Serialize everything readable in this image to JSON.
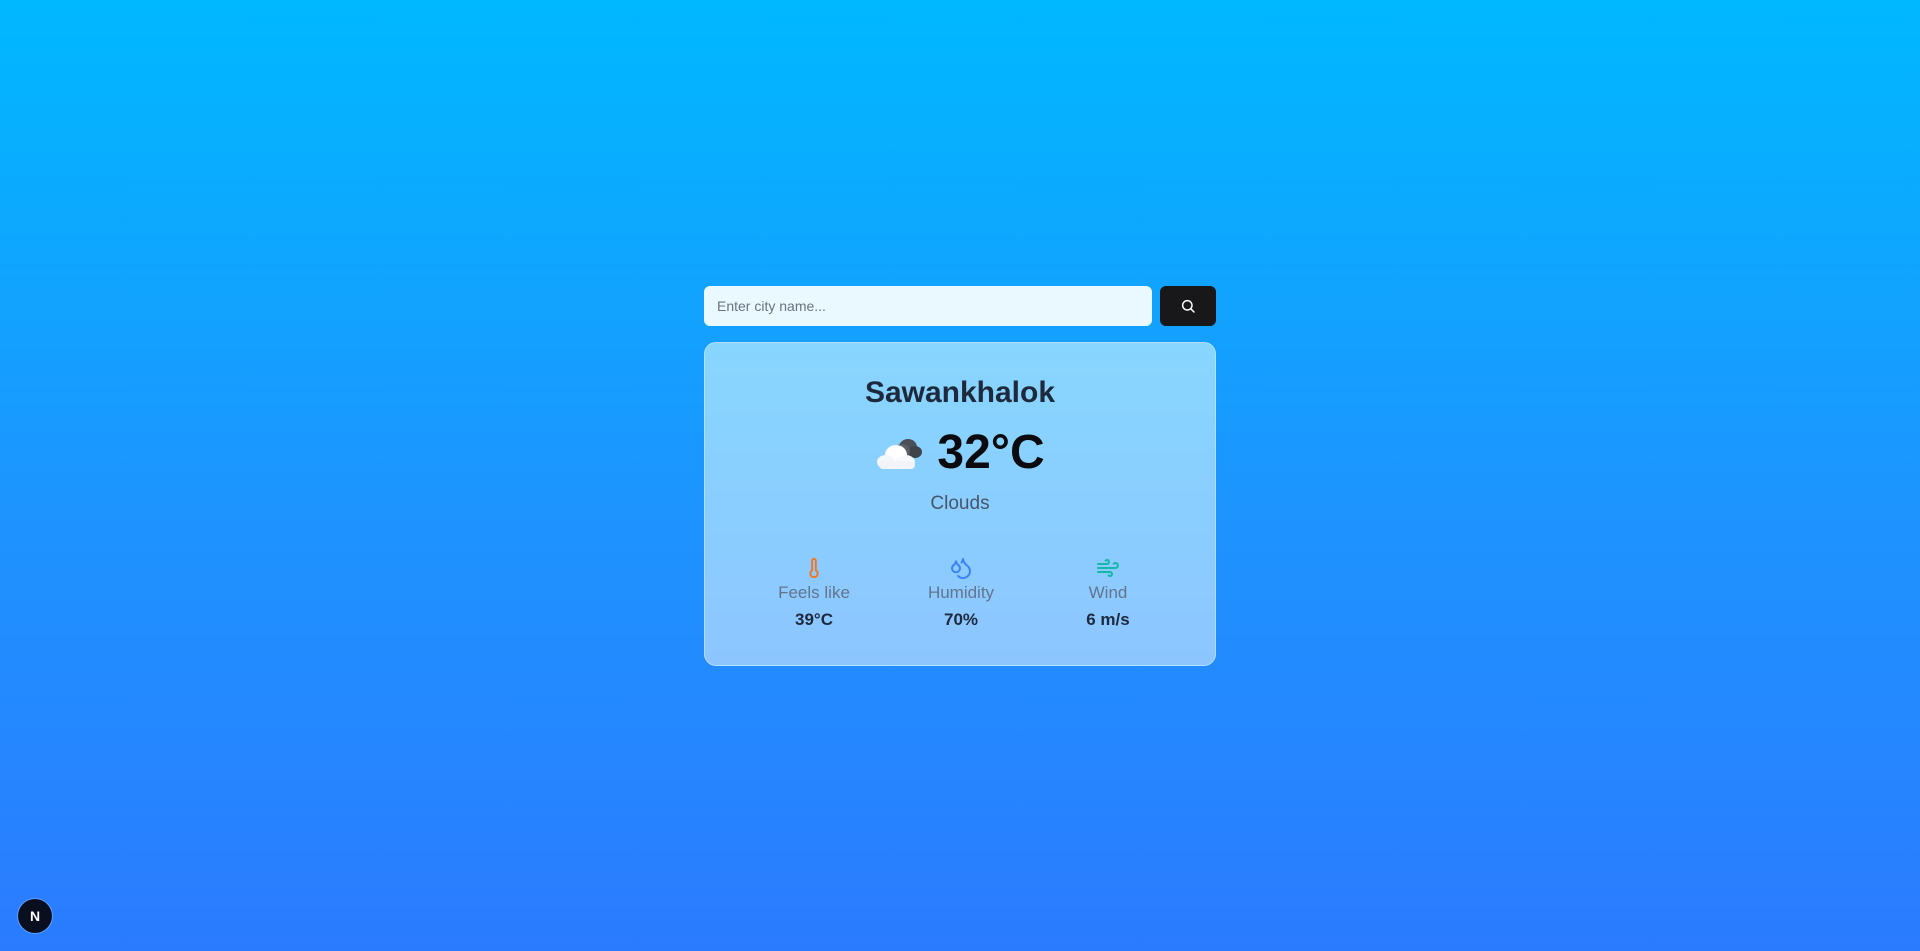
{
  "search": {
    "placeholder": "Enter city name...",
    "value": "",
    "button_icon": "search-icon"
  },
  "weather": {
    "city": "Sawankhalok",
    "temperature": "32°C",
    "condition_icon": "cloud-icon",
    "description": "Clouds"
  },
  "stats": [
    {
      "label": "Feels like",
      "value": "39°C",
      "icon": "thermometer-icon",
      "icon_color": "#f97316"
    },
    {
      "label": "Humidity",
      "value": "70%",
      "icon": "droplets-icon",
      "icon_color": "#3b82f6"
    },
    {
      "label": "Wind",
      "value": "6 m/s",
      "icon": "wind-icon",
      "icon_color": "#14b8a6"
    }
  ],
  "dev_badge": {
    "label": "N",
    "icon": "nextjs-logo-icon"
  },
  "colors": {
    "background_top": "#00b8ff",
    "background_bottom": "#2b7bff",
    "card": "#8ccfff",
    "search_button": "#18181b"
  }
}
